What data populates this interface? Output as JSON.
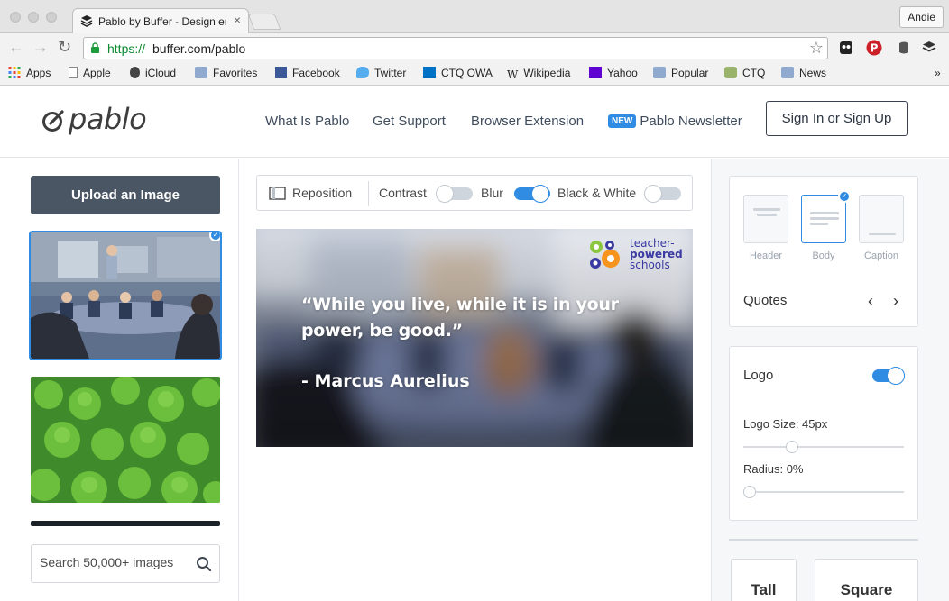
{
  "browser": {
    "tab_title": "Pablo by Buffer - Design en",
    "tab_close": "×",
    "profile": "Andie",
    "url_scheme": "https://",
    "url_rest": "buffer.com/pablo",
    "bookmarks": [
      "Apps",
      "Apple",
      "iCloud",
      "Favorites",
      "Facebook",
      "Twitter",
      "CTQ OWA",
      "Wikipedia",
      "Yahoo",
      "Popular",
      "CTQ",
      "News"
    ],
    "more": "»"
  },
  "header": {
    "logo": "pablo",
    "nav": [
      "What Is Pablo",
      "Get Support",
      "Browser Extension"
    ],
    "new_badge": "NEW",
    "newsletter": "Pablo Newsletter",
    "signin": "Sign In or Sign Up"
  },
  "left": {
    "upload": "Upload an Image",
    "search_placeholder": "Search 50,000+ images"
  },
  "editor": {
    "reposition": "Reposition",
    "contrast": "Contrast",
    "blur": "Blur",
    "bw": "Black & White",
    "toggles": {
      "contrast": false,
      "blur": true,
      "bw": false
    },
    "quote": "“While you live, while it is in your power, be good.”",
    "author": "- Marcus Aurelius",
    "overlay_logo": [
      "teacher-",
      "powered",
      "schools"
    ]
  },
  "right": {
    "styles": [
      "Header",
      "Body",
      "Caption"
    ],
    "active_style": "Body",
    "quotes_label": "Quotes",
    "prev": "‹",
    "next": "›",
    "logo_label": "Logo",
    "logo_on": true,
    "logo_size": "Logo Size: 45px",
    "radius": "Radius: 0%",
    "sizes": [
      "Tall",
      "Square"
    ]
  },
  "colors": {
    "accent": "#2f8ce2",
    "upload_bg": "#4a5663"
  }
}
